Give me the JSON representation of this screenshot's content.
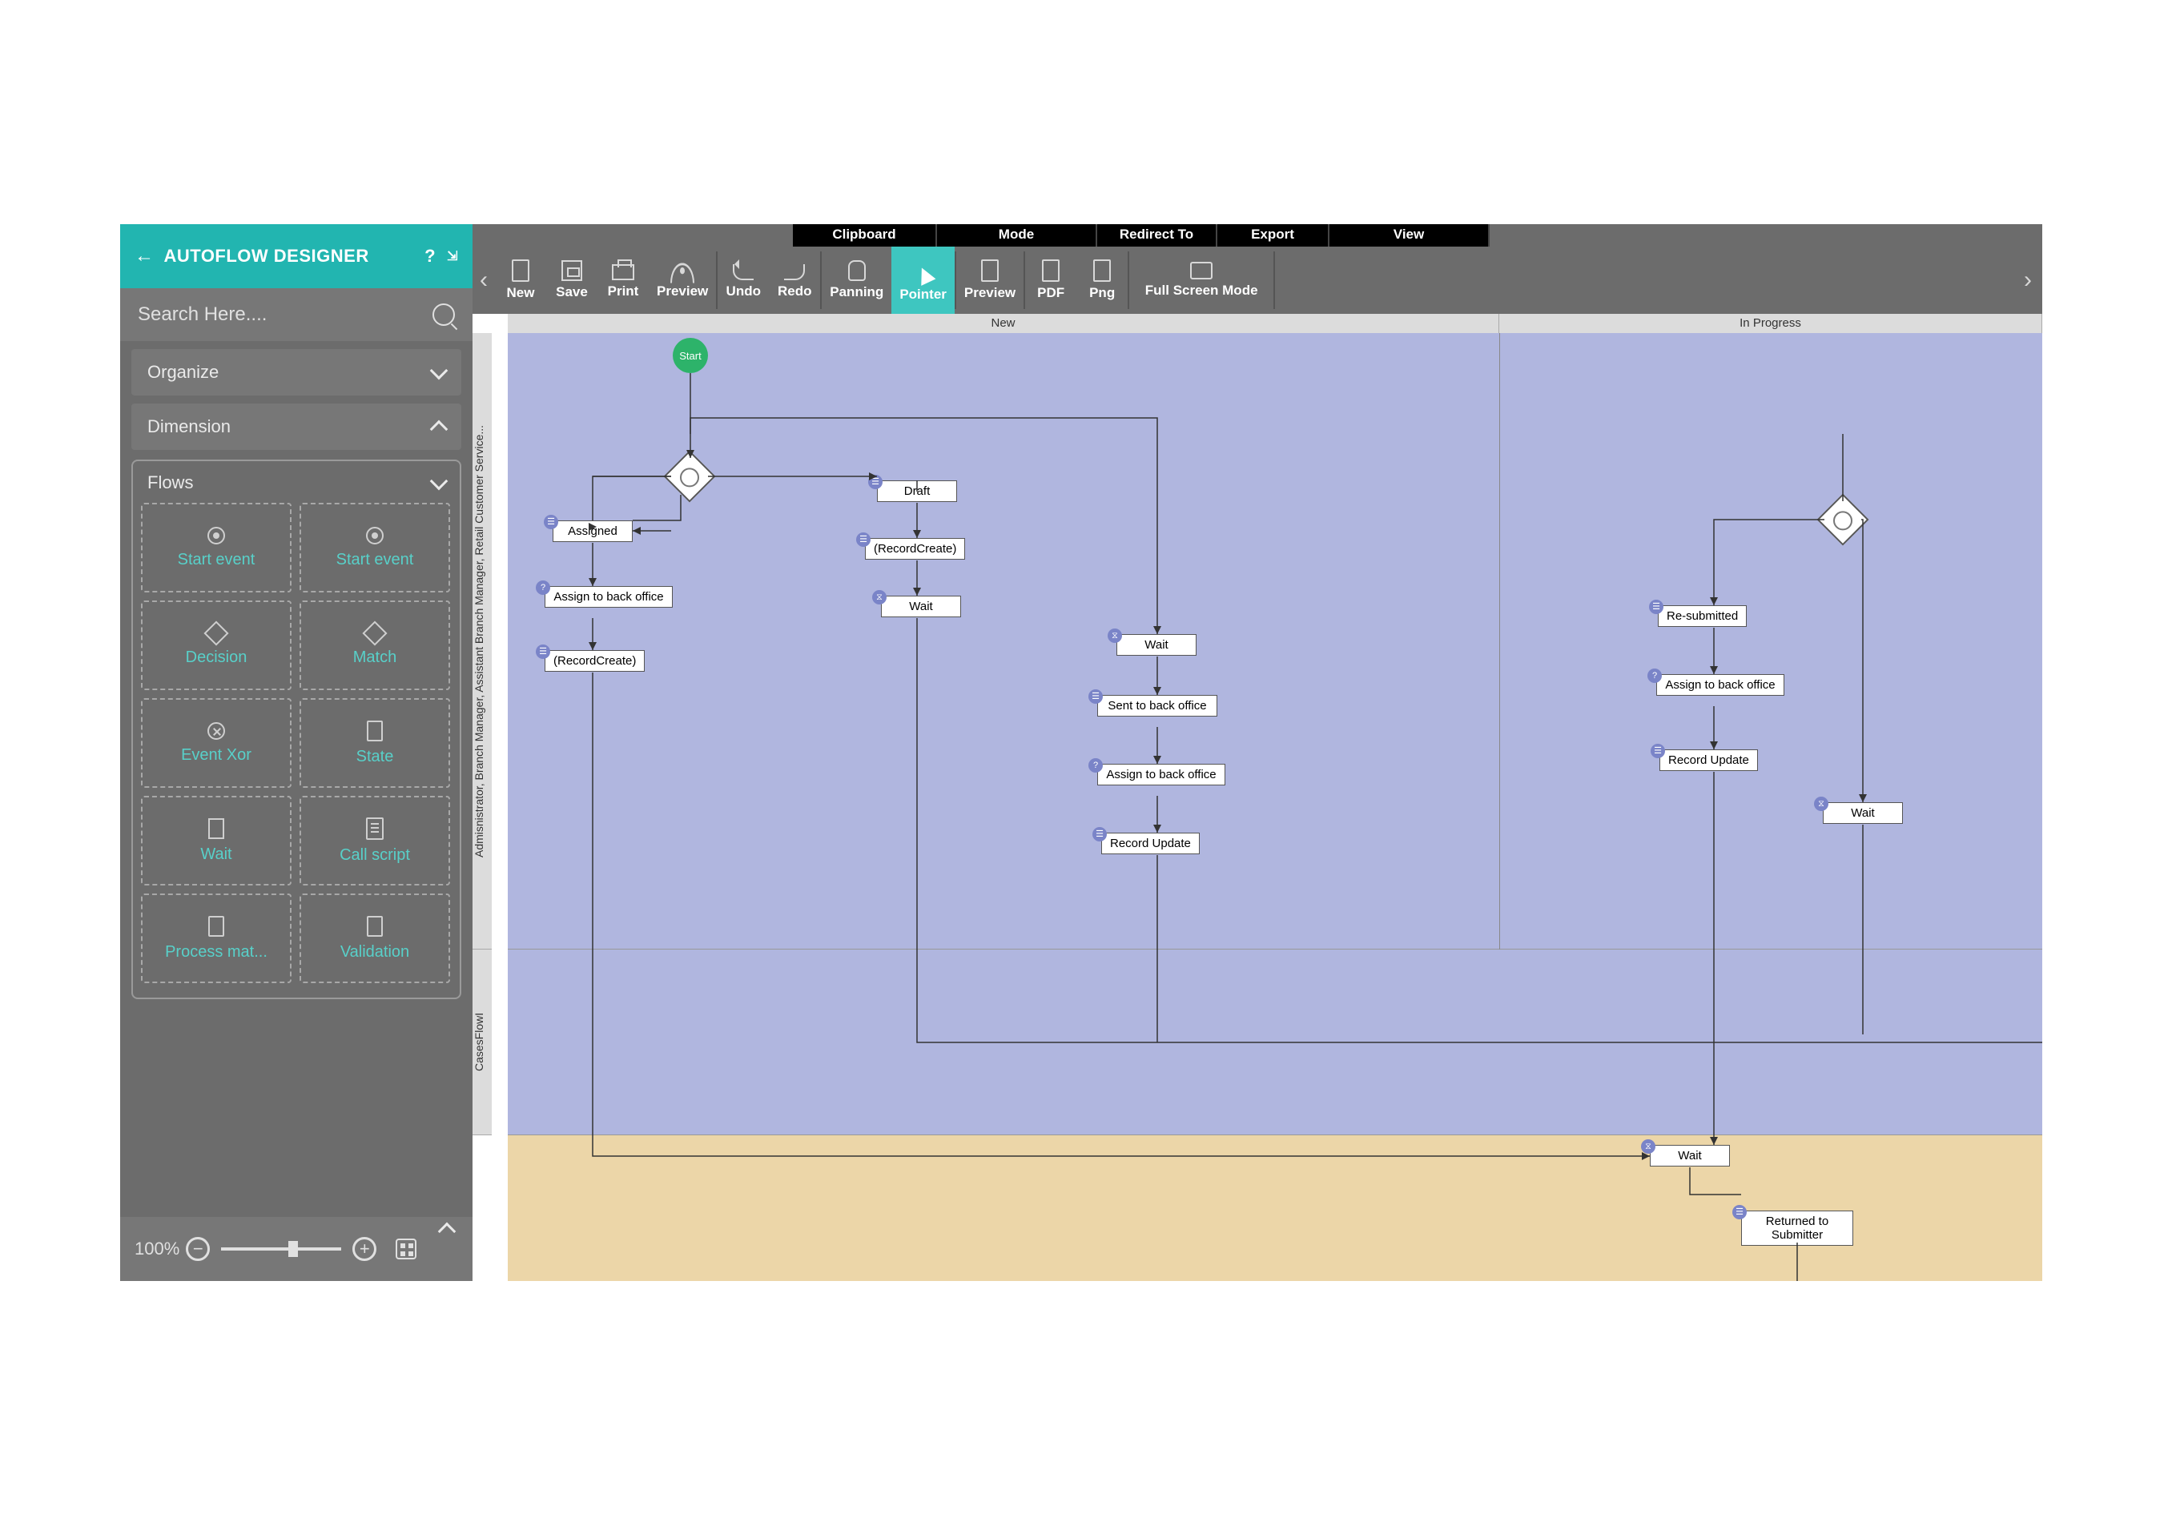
{
  "header": {
    "title": "AUTOFLOW DESIGNER"
  },
  "search": {
    "placeholder": "Search Here...."
  },
  "panels": {
    "organize": "Organize",
    "dimension": "Dimension",
    "flows": "Flows"
  },
  "stencils": [
    {
      "label": "Start event",
      "icon": "dot"
    },
    {
      "label": "Start event",
      "icon": "dot"
    },
    {
      "label": "Decision",
      "icon": "diamond"
    },
    {
      "label": "Match",
      "icon": "diamond"
    },
    {
      "label": "Event Xor",
      "icon": "diamond-x"
    },
    {
      "label": "State",
      "icon": "page"
    },
    {
      "label": "Wait",
      "icon": "hourglass"
    },
    {
      "label": "Call script",
      "icon": "doc"
    },
    {
      "label": "Process mat...",
      "icon": "page"
    },
    {
      "label": "Validation",
      "icon": "page"
    }
  ],
  "zoom": {
    "value": "100%"
  },
  "tabs": {
    "clipboard": "Clipboard",
    "mode": "Mode",
    "redirect": "Redirect To",
    "export": "Export",
    "view": "View"
  },
  "ribbon": {
    "new": "New",
    "save": "Save",
    "print": "Print",
    "preview": "Preview",
    "undo": "Undo",
    "redo": "Redo",
    "panning": "Panning",
    "pointer": "Pointer",
    "preview2": "Preview",
    "pdf": "PDF",
    "png": "Png",
    "fullscreen": "Full Screen Mode"
  },
  "swimlanes": {
    "cols": {
      "new": "New",
      "inprogress": "In Progress"
    },
    "rows": {
      "r1": "Admisnistrator, Branch Manager, Assistant Branch Manager, Retail Customer Service...",
      "r2": "CasesFlowI"
    }
  },
  "nodes": {
    "start": "Start",
    "assigned": "Assigned",
    "assign_back": "Assign to back office",
    "record_create1": "(RecordCreate)",
    "draft": "Draft",
    "record_create2": "(RecordCreate)",
    "wait1": "Wait",
    "wait2": "Wait",
    "sent_back": "Sent to back office",
    "assign_back2": "Assign to back office",
    "record_update": "Record Update",
    "resubmitted": "Re-submitted",
    "assign_back3": "Assign to back office",
    "record_update2": "Record Update",
    "wait3": "Wait",
    "wait4": "Wait",
    "returned": "Returned to Submitter"
  }
}
